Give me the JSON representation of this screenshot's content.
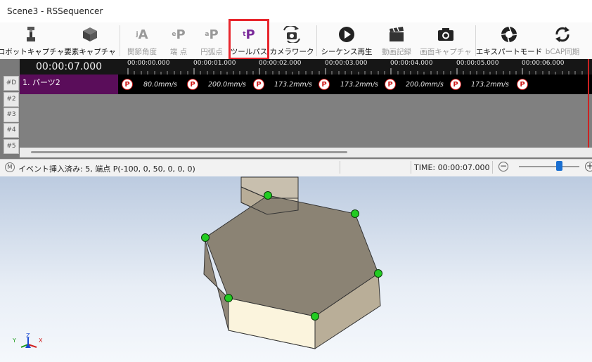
{
  "window": {
    "title": "Scene3 - RSSequencer"
  },
  "toolbar": {
    "buttons": [
      {
        "label": "ロボットキャプチャ",
        "icon": "robot-capture-icon",
        "enabled": true
      },
      {
        "label": "要素キャプチャ",
        "icon": "cube-icon",
        "enabled": true
      },
      {
        "label": "関節角度",
        "icon": "joint-angle-icon",
        "glyph": "A",
        "prefix": "j",
        "enabled": false
      },
      {
        "label": "端 点",
        "icon": "end-point-icon",
        "glyph": "P",
        "prefix": "e",
        "enabled": false
      },
      {
        "label": "円弧点",
        "icon": "arc-point-icon",
        "glyph": "P",
        "prefix": "a",
        "enabled": false
      },
      {
        "label": "ツールパス",
        "icon": "tool-path-icon",
        "glyph": "P",
        "prefix": "t",
        "enabled": true,
        "highlighted": true
      },
      {
        "label": "カメラワーク",
        "icon": "camera-work-icon",
        "enabled": true
      },
      {
        "label": "シーケンス再生",
        "icon": "play-icon",
        "enabled": true
      },
      {
        "label": "動画記録",
        "icon": "clapper-icon",
        "enabled": false
      },
      {
        "label": "画面キャプチャ",
        "icon": "camera-icon",
        "enabled": false
      },
      {
        "label": "エキスパートモード",
        "icon": "aperture-icon",
        "enabled": true
      },
      {
        "label": "bCAP同期",
        "icon": "sync-icon",
        "enabled": false
      }
    ],
    "highlight_color": "#e8262d"
  },
  "sequencer": {
    "current_time": "00:00:07.000",
    "ruler_labels": [
      "00:00:00.000",
      "00:00:01.000",
      "00:00:02.000",
      "00:00:03.000",
      "00:00:04.000",
      "00:00:05.000",
      "00:00:06.000"
    ],
    "rows": [
      "#D",
      "#2",
      "#3",
      "#4",
      "#5"
    ],
    "track1": {
      "name": "1. パーツ2",
      "color": "#5a0d5a",
      "marker_label": "P",
      "segments": [
        "80.0mm/s",
        "200.0mm/s",
        "173.2mm/s",
        "173.2mm/s",
        "200.0mm/s",
        "173.2mm/s"
      ]
    }
  },
  "status": {
    "mode_icon": "M",
    "message": "イベント挿入済み: 5, 端点 P(-100, 0, 50, 0, 0, 0)",
    "time": "TIME: 00:00:07.000",
    "zoom_level": 0.62,
    "zoom_minus": "−",
    "zoom_plus": "+"
  },
  "viewport": {
    "axes": {
      "x": "X",
      "y": "Y",
      "z": "Z"
    },
    "point_color": "#22cc22"
  }
}
